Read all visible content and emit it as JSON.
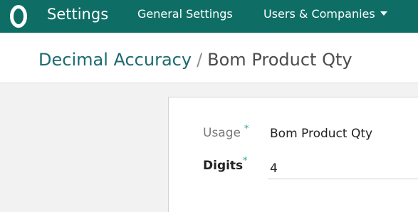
{
  "navbar": {
    "app_title": "Settings",
    "menu": {
      "general_settings": "General Settings",
      "users_companies": "Users & Companies"
    },
    "background_color": "#0e6e66",
    "logo_icon": "odoo-logo-icon"
  },
  "breadcrumb": {
    "parent": "Decimal Accuracy",
    "separator": "/",
    "current": "Bom Product Qty"
  },
  "form": {
    "usage": {
      "label": "Usage",
      "required_mark": "*",
      "value": "Bom Product Qty"
    },
    "digits": {
      "label": "Digits",
      "required_mark": "*",
      "value": "4"
    }
  },
  "colors": {
    "accent": "#1d6a70",
    "required": "#3aa19a"
  }
}
